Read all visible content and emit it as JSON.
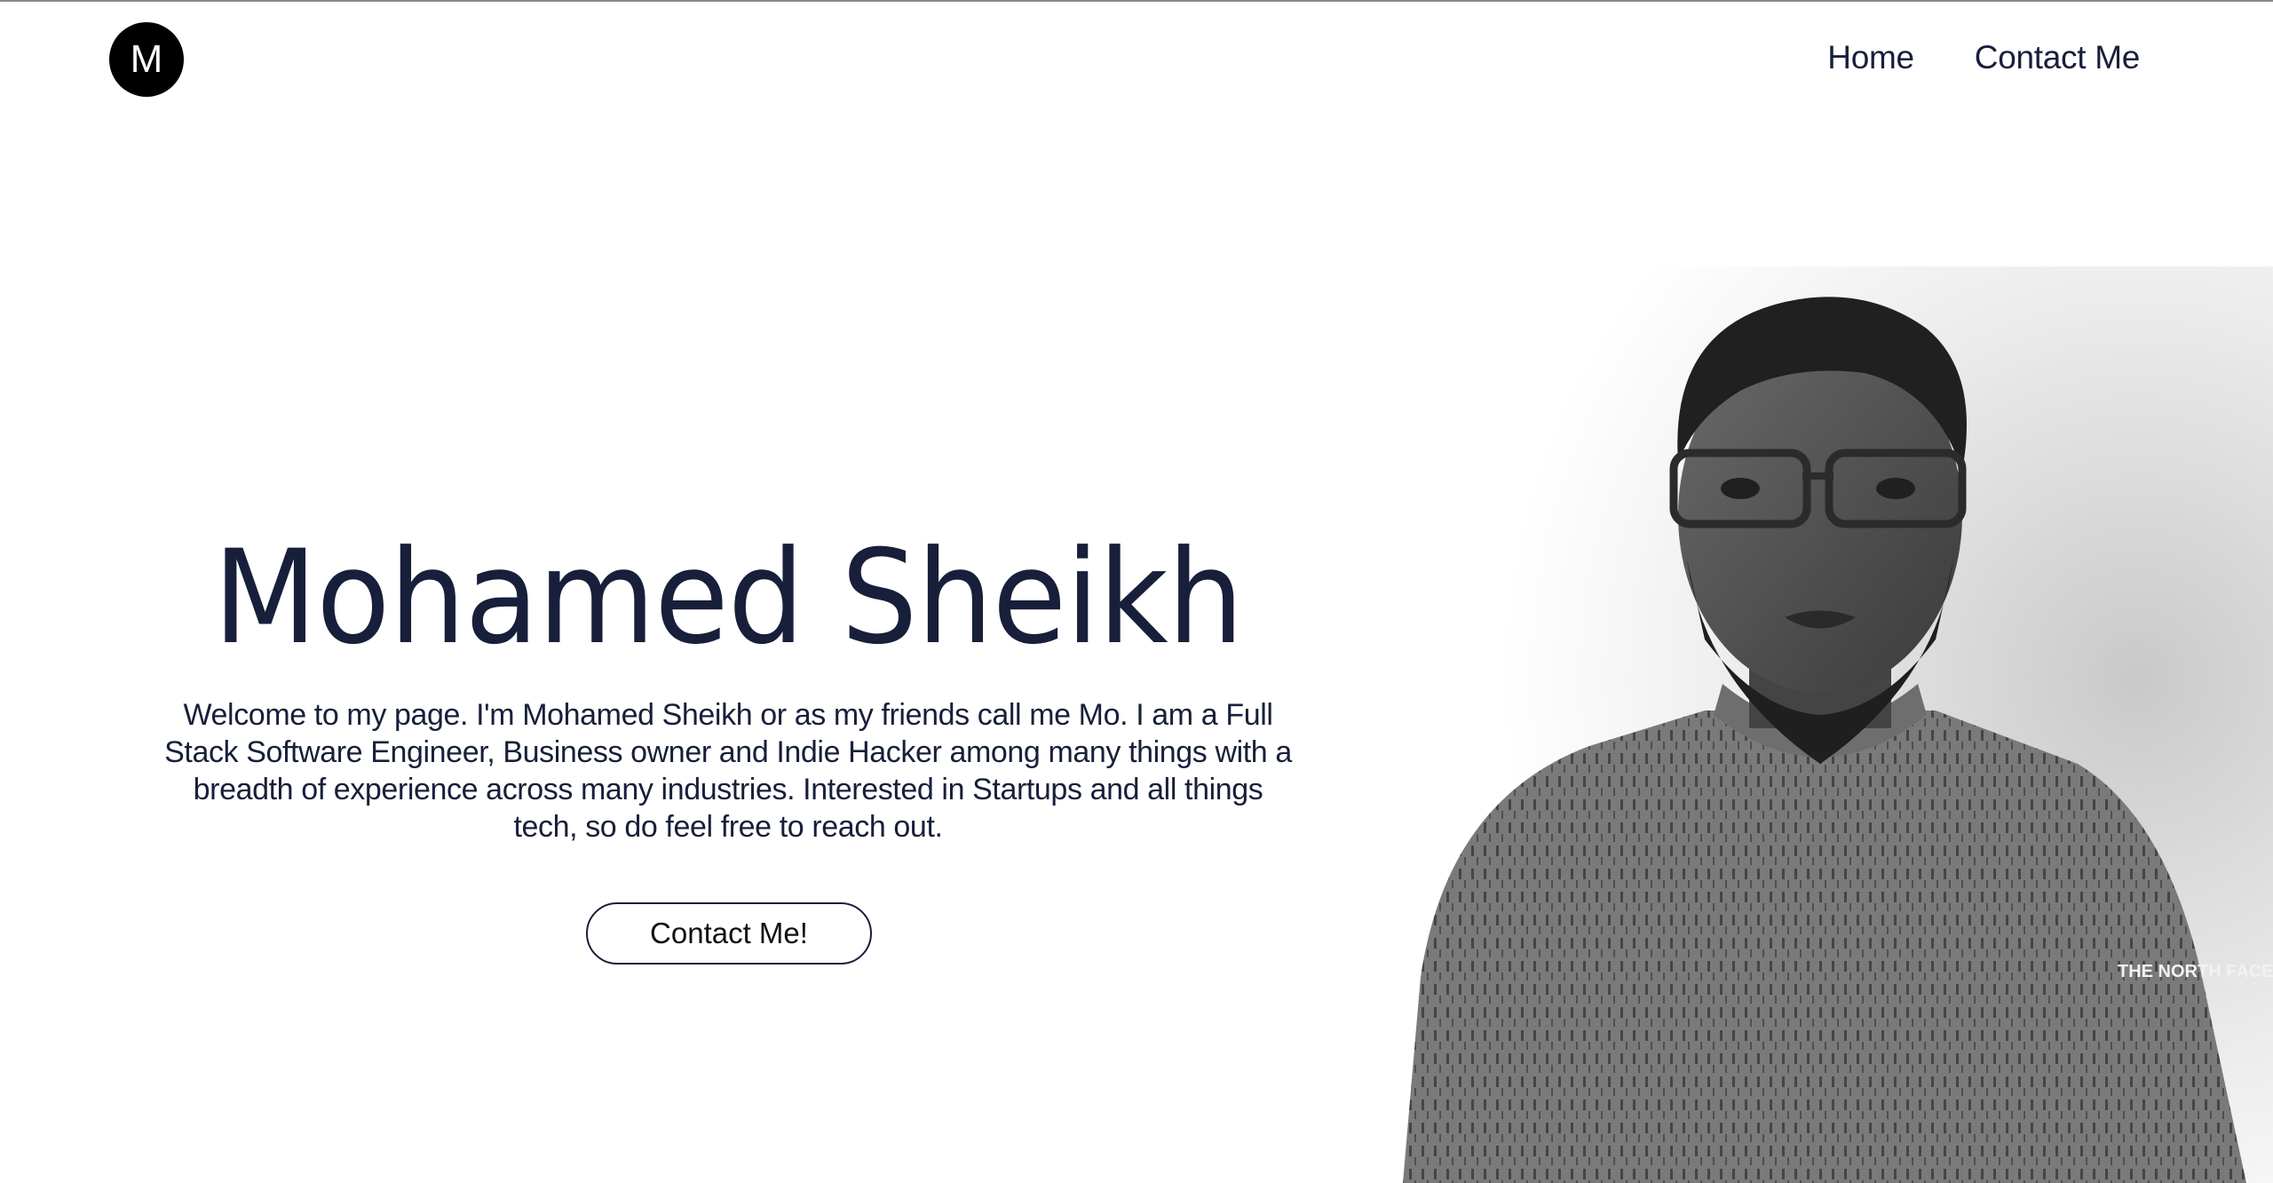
{
  "header": {
    "logo_letter": "M",
    "nav": [
      {
        "label": "Home"
      },
      {
        "label": "Contact Me"
      }
    ]
  },
  "hero": {
    "name": "Mohamed Sheikh",
    "intro": "Welcome to my page. I'm Mohamed Sheikh or as my friends call me Mo. I am a Full Stack Software Engineer, Business owner and Indie Hacker among many things with a breadth of experience across many industries. Interested in Startups and all things tech, so do feel free to reach out.",
    "cta_label": "Contact Me!"
  },
  "portrait": {
    "alt": "Black and white portrait photo",
    "shirt_logo": "THE NORTH FACE"
  },
  "colors": {
    "text": "#171f3a",
    "logo_bg": "#000000",
    "page_bg": "#ffffff"
  }
}
